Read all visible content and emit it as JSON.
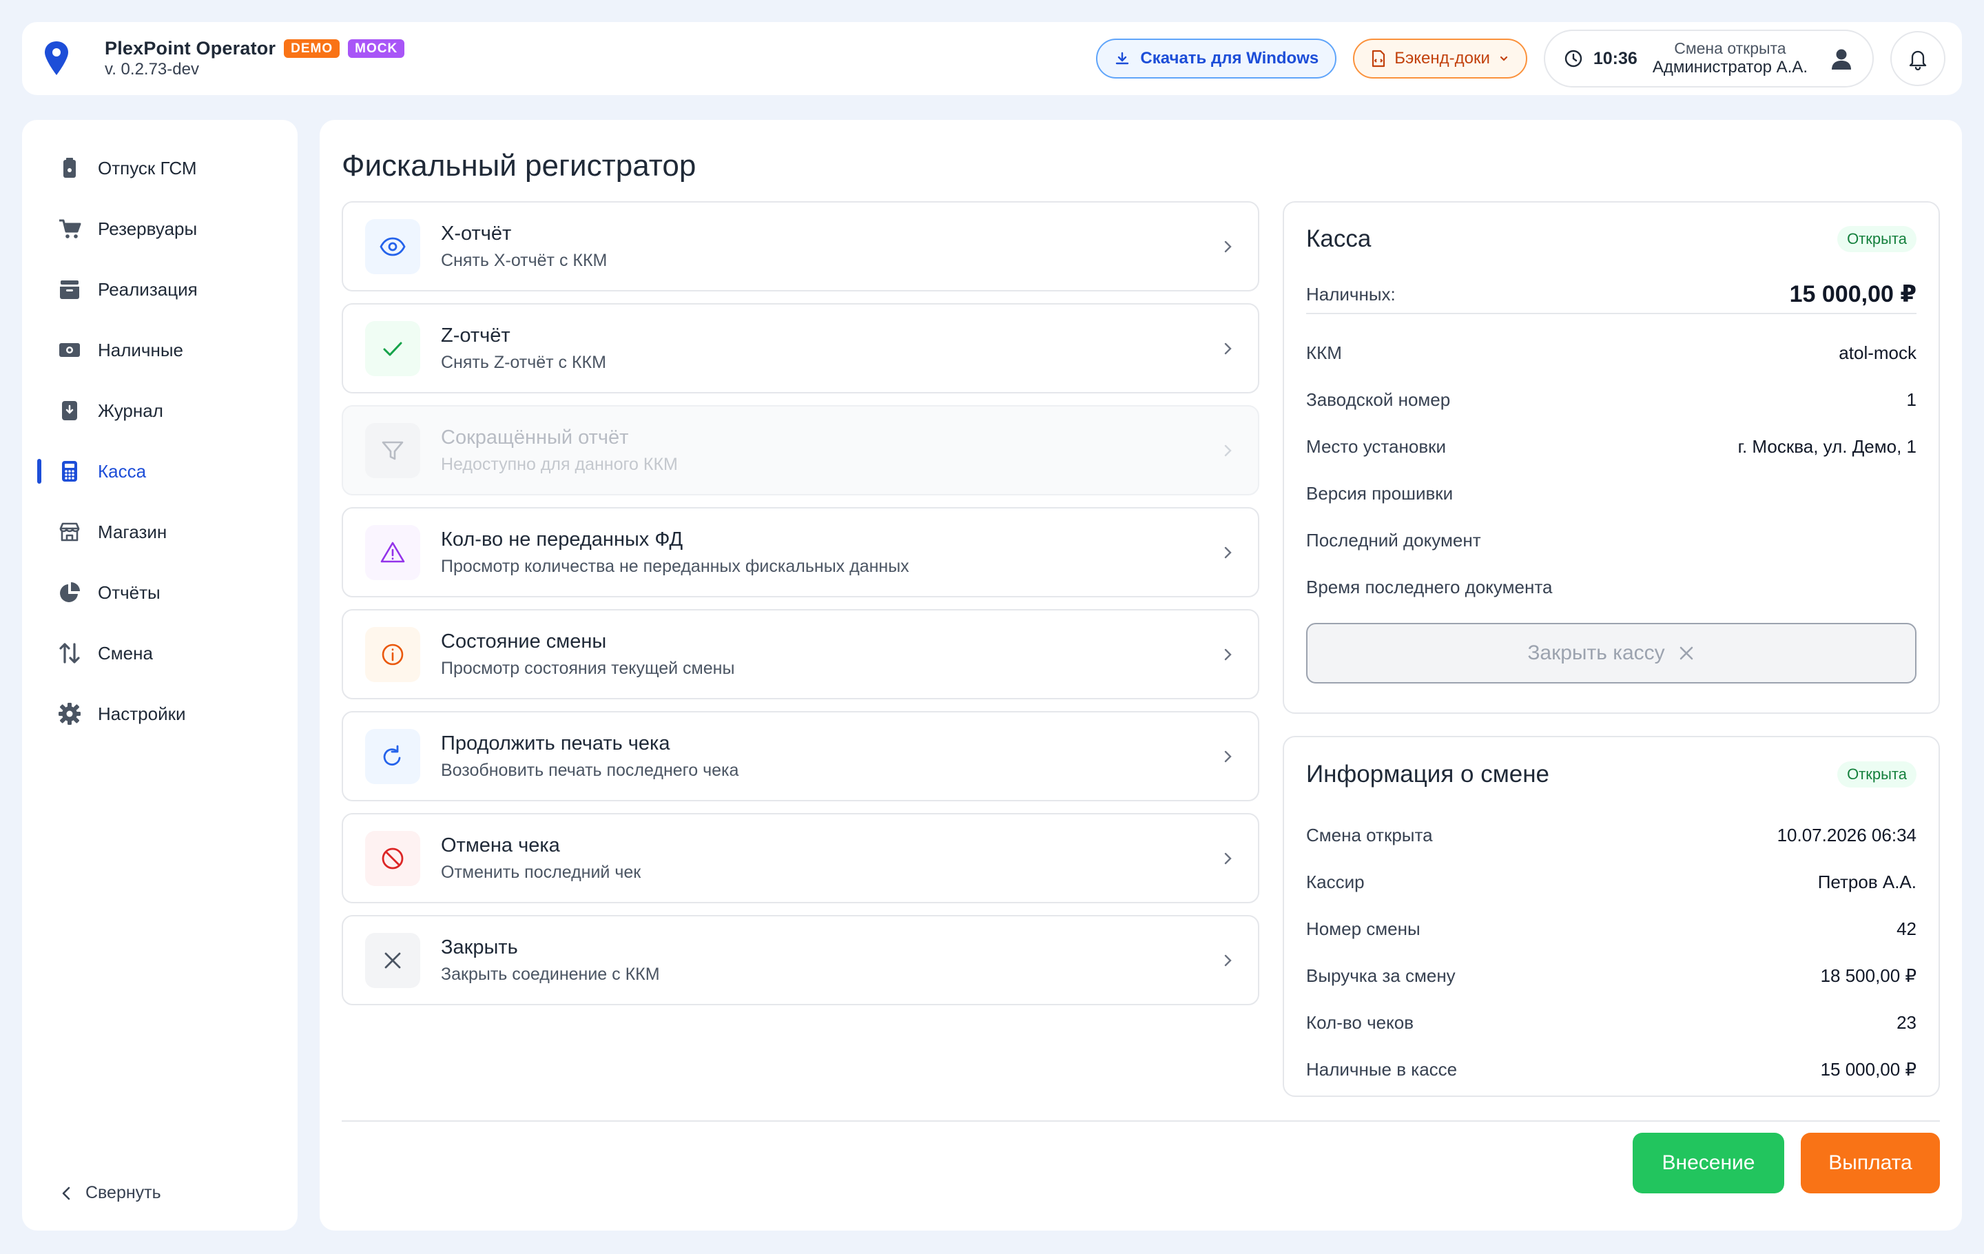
{
  "app": {
    "name": "PlexPoint Operator",
    "version": "v. 0.2.73-dev",
    "tags": [
      "DEMO",
      "MOCK"
    ]
  },
  "header": {
    "download_label": "Скачать для Windows",
    "docs_label": "Бэкенд-доки",
    "time": "10:36",
    "shift_status": "Смена открыта",
    "user_name": "Администратор А.А."
  },
  "sidebar": {
    "items": [
      {
        "label": "Отпуск ГСМ",
        "icon": "fuel-icon"
      },
      {
        "label": "Резервуары",
        "icon": "cart-icon"
      },
      {
        "label": "Реализация",
        "icon": "inbox-icon"
      },
      {
        "label": "Наличные",
        "icon": "cash-icon"
      },
      {
        "label": "Журнал",
        "icon": "journal-icon"
      },
      {
        "label": "Касса",
        "icon": "calculator-icon",
        "active": true
      },
      {
        "label": "Магазин",
        "icon": "store-icon"
      },
      {
        "label": "Отчёты",
        "icon": "pie-chart-icon"
      },
      {
        "label": "Смена",
        "icon": "swap-arrows-icon"
      },
      {
        "label": "Настройки",
        "icon": "gear-icon"
      }
    ],
    "collapse_label": "Свернуть"
  },
  "main": {
    "title": "Фискальный регистратор",
    "actions": [
      {
        "title": "X-отчёт",
        "subtitle": "Снять X-отчёт с ККМ",
        "icon": "eye-icon",
        "color": "#2563eb"
      },
      {
        "title": "Z-отчёт",
        "subtitle": "Снять Z-отчёт с ККМ",
        "icon": "check-icon",
        "color": "#16a34a"
      },
      {
        "title": "Сокращённый отчёт",
        "subtitle": "Недоступно для данного ККМ",
        "icon": "filter-icon",
        "color": "#9ca3af",
        "disabled": true
      },
      {
        "title": "Кол-во не переданных ФД",
        "subtitle": "Просмотр количества не переданных фискальных данных",
        "icon": "warning-icon",
        "color": "#9333ea"
      },
      {
        "title": "Состояние смены",
        "subtitle": "Просмотр состояния текущей смены",
        "icon": "info-icon",
        "color": "#ea580c"
      },
      {
        "title": "Продолжить печать чека",
        "subtitle": "Возобновить печать последнего чека",
        "icon": "refresh-icon",
        "color": "#2563eb"
      },
      {
        "title": "Отмена чека",
        "subtitle": "Отменить последний чек",
        "icon": "ban-icon",
        "color": "#dc2626"
      },
      {
        "title": "Закрыть",
        "subtitle": "Закрыть соединение с ККМ",
        "icon": "close-icon",
        "color": "#4b5563"
      }
    ]
  },
  "kassa": {
    "title": "Касса",
    "status": "Открыта",
    "cash_label": "Наличных:",
    "cash_value": "15 000,00 ₽",
    "rows": [
      {
        "label": "ККМ",
        "value": "atol-mock"
      },
      {
        "label": "Заводской номер",
        "value": "1"
      },
      {
        "label": "Место установки",
        "value": "г. Москва, ул. Демо, 1"
      },
      {
        "label": "Версия прошивки",
        "value": ""
      },
      {
        "label": "Последний документ",
        "value": ""
      },
      {
        "label": "Время последнего документа",
        "value": ""
      }
    ],
    "close_label": "Закрыть кассу"
  },
  "shift": {
    "title": "Информация о смене",
    "status": "Открыта",
    "rows": [
      {
        "label": "Смена открыта",
        "value": "10.07.2026 06:34"
      },
      {
        "label": "Кассир",
        "value": "Петров А.А."
      },
      {
        "label": "Номер смены",
        "value": "42"
      },
      {
        "label": "Выручка за смену",
        "value": "18 500,00 ₽"
      },
      {
        "label": "Кол-во чеков",
        "value": "23"
      },
      {
        "label": "Наличные в кассе",
        "value": "15 000,00 ₽"
      }
    ]
  },
  "footer": {
    "deposit_label": "Внесение",
    "payout_label": "Выплата"
  },
  "colors": {
    "accent": "#1d4ed8",
    "deposit": "#22c55e",
    "payout": "#f97316",
    "status_open": "#15803d"
  }
}
